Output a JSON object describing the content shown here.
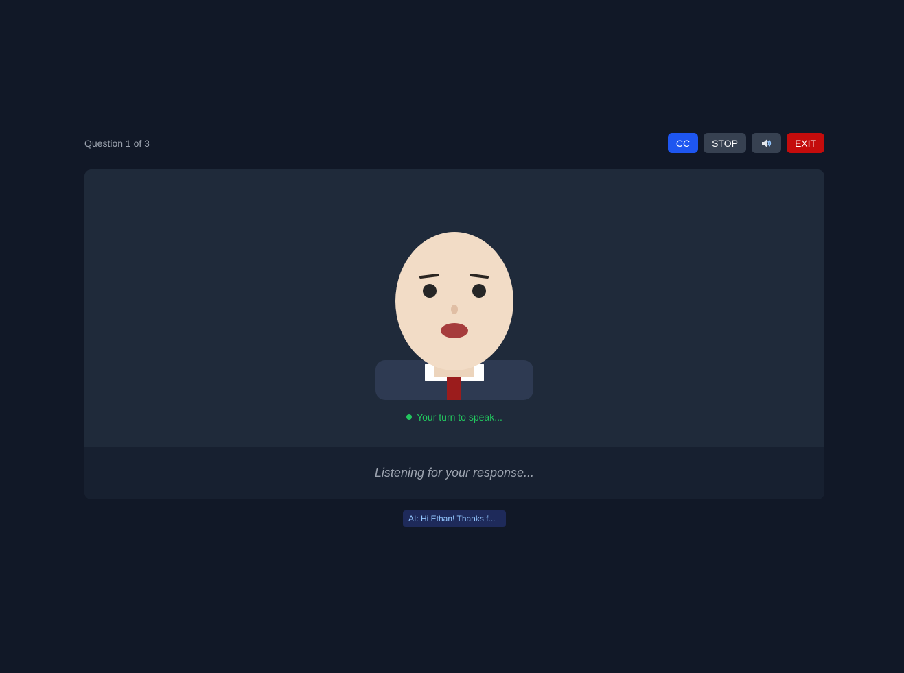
{
  "header": {
    "question_counter": "Question 1 of 3"
  },
  "controls": {
    "cc_label": "CC",
    "stop_label": "STOP",
    "sound_icon": "speaker-icon",
    "exit_label": "EXIT"
  },
  "stage": {
    "status_text": "Your turn to speak...",
    "listening_text": "Listening for your response..."
  },
  "caption": {
    "text": "AI: Hi Ethan! Thanks f..."
  },
  "colors": {
    "background": "#111827",
    "cc_button": "#1e56f0",
    "exit_button": "#c40c0c",
    "status_green": "#22c55e"
  }
}
